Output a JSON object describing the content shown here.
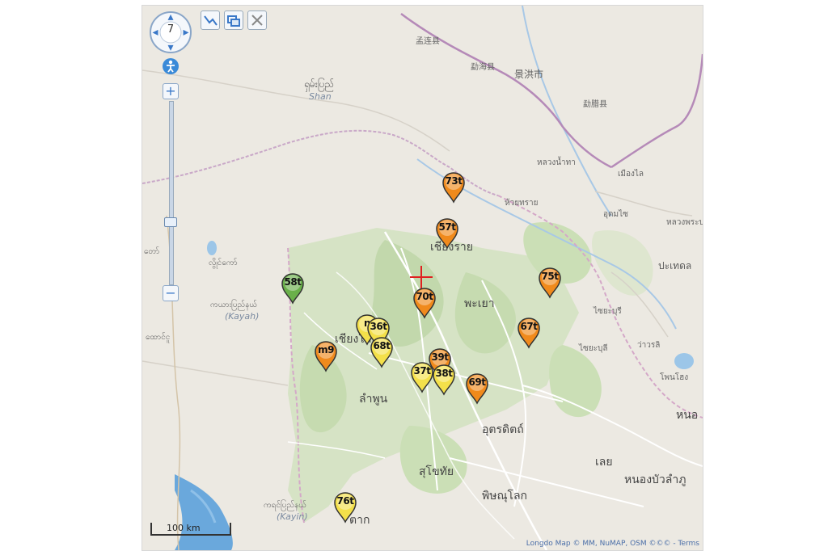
{
  "map": {
    "zoom_level": "7",
    "scale_label": "100 km",
    "attribution": "Longdo Map © MM, NuMAP, OSM ©©© - Terms"
  },
  "controls": {
    "zoom_in": "+",
    "zoom_out": "−",
    "tools": [
      "draw-line-icon",
      "layers-icon",
      "close-icon"
    ]
  },
  "labels": [
    {
      "text": "孟连县",
      "name": "label-menglian"
    },
    {
      "text": "勐海县",
      "name": "label-menghai"
    },
    {
      "text": "景洪市",
      "name": "label-jinghong"
    },
    {
      "text": "勐腊县",
      "name": "label-mengla"
    },
    {
      "text": "ရှမ်းပြည်",
      "name": "label-shan-burmese"
    },
    {
      "text": "Shan",
      "name": "label-shan"
    },
    {
      "text": "เมืองไล",
      "name": "label-muang-lai"
    },
    {
      "text": "หลวงน้ำทา",
      "name": "label-luang-namtha"
    },
    {
      "text": "ห้วยทราย",
      "name": "label-huay-xai"
    },
    {
      "text": "อุดมไซ",
      "name": "label-oudomxay"
    },
    {
      "text": "หลวงพระบาง",
      "name": "label-luang-prabang"
    },
    {
      "text": "ปะเทดล",
      "name": "label-patedl"
    },
    {
      "text": "ไซยะบุรี",
      "name": "label-sayaboury"
    },
    {
      "text": "ไซยะบุลี",
      "name": "label-sayabuli"
    },
    {
      "text": "ว่าวรลิ",
      "name": "label-waworli"
    },
    {
      "text": "โพนโฮง",
      "name": "label-phonhong"
    },
    {
      "text": "เชียงราย",
      "name": "label-chiang-rai"
    },
    {
      "text": "พะเยา",
      "name": "label-phayao"
    },
    {
      "text": "เชียงใหม่",
      "name": "label-chiang-mai"
    },
    {
      "text": "ลำพูน",
      "name": "label-lamphun"
    },
    {
      "text": "อุตรดิตถ์",
      "name": "label-uttaradit"
    },
    {
      "text": "สุโขทัย",
      "name": "label-sukhothai"
    },
    {
      "text": "พิษณุโลก",
      "name": "label-phitsanulok"
    },
    {
      "text": "ตาก",
      "name": "label-tak"
    },
    {
      "text": "เลย",
      "name": "label-loei"
    },
    {
      "text": "หนองบัวลำภู",
      "name": "label-nong-bua-lamphu"
    },
    {
      "text": "หนอ",
      "name": "label-nong"
    },
    {
      "text": "ကယားပြည်နယ်",
      "name": "label-kayah-burmese"
    },
    {
      "text": "(Kayah)",
      "name": "label-kayah"
    },
    {
      "text": "ကရင်ပြည်နယ်",
      "name": "label-kayin-burmese"
    },
    {
      "text": "(Kayin)",
      "name": "label-kayin"
    },
    {
      "text": "လွိုင်ကော်",
      "name": "label-loikaw"
    },
    {
      "text": "တော်",
      "name": "label-taw"
    },
    {
      "text": "ထောင်ငူ",
      "name": "label-taungoo"
    }
  ],
  "markers": [
    {
      "label": "73t",
      "color": "#f08a1c"
    },
    {
      "label": "57t",
      "color": "#f08a1c"
    },
    {
      "label": "75t",
      "color": "#f08a1c"
    },
    {
      "label": "58t",
      "color": "#6ab04a"
    },
    {
      "label": "70t",
      "color": "#f08a1c"
    },
    {
      "label": "n",
      "color": "#f4e04a"
    },
    {
      "label": "36t",
      "color": "#f4e04a"
    },
    {
      "label": "68t",
      "color": "#f4e04a"
    },
    {
      "label": "67t",
      "color": "#f08a1c"
    },
    {
      "label": "m9",
      "color": "#f08a1c"
    },
    {
      "label": "39t",
      "color": "#f08a1c"
    },
    {
      "label": "37t",
      "color": "#f4e04a"
    },
    {
      "label": "38t",
      "color": "#f4e04a"
    },
    {
      "label": "69t",
      "color": "#f08a1c"
    },
    {
      "label": "76t",
      "color": "#f4e04a"
    }
  ],
  "colors": {
    "land": "#ece9e2",
    "forest": "#c8dcb4",
    "water": "#6aa8dc",
    "road": "#ffffff",
    "border": "#b58ab8",
    "crosshair": "#e02020"
  }
}
